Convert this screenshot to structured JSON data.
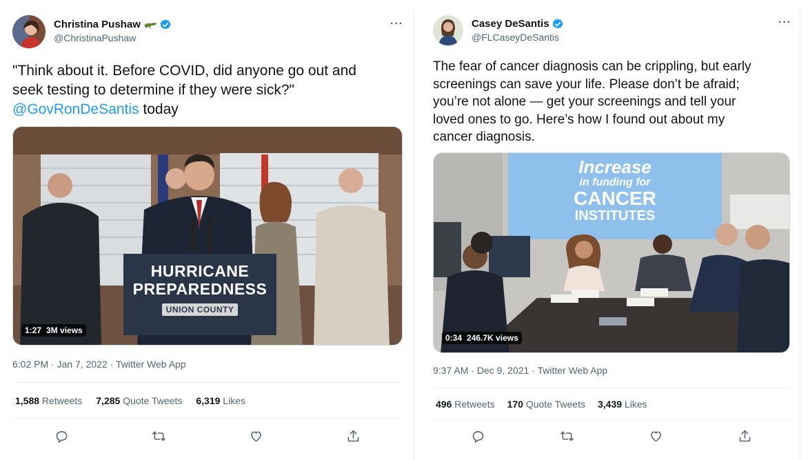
{
  "left": {
    "name": "Christina Pushaw",
    "name_emoji": "alligator-emoji",
    "handle": "@ChristinaPushaw",
    "text_line1": "\"Think about it. Before COVID, did anyone go out and",
    "text_line2": "seek testing to determine if they were sick?\"",
    "mention": "@GovRonDeSantis",
    "text_after_mention": " today",
    "video_duration": "1:27",
    "video_views": "3M views",
    "podium_line1": "HURRICANE",
    "podium_line2": "PREPAREDNESS",
    "podium_line3": "UNION COUNTY",
    "timestamp": "6:02 PM · Jan 7, 2022 · Twitter Web App",
    "retweets": "1,588",
    "retweets_label": " Retweets",
    "quotes": "7,285",
    "quotes_label": " Quote Tweets",
    "likes": "6,319",
    "likes_label": " Likes"
  },
  "right": {
    "name": "Casey DeSantis",
    "handle": "@FLCaseyDeSantis",
    "text_lines": [
      "The fear of cancer diagnosis can be crippling, but early",
      "screenings can save your life. Please don’t be afraid;",
      "you’re not alone — get your screenings and tell your",
      "loved ones to go. Here’s how I found out about my",
      "cancer diagnosis."
    ],
    "screen_line1": "Increase",
    "screen_line2": "in funding for",
    "screen_line3": "CANCER",
    "screen_line4": "INSTITUTES",
    "video_duration": "0:34",
    "video_views": "246.7K views",
    "timestamp": "9:37 AM · Dec 9, 2021 · Twitter Web App",
    "retweets": "496",
    "retweets_label": " Retweets",
    "quotes": "170",
    "quotes_label": " Quote Tweets",
    "likes": "3,439",
    "likes_label": " Likes"
  },
  "more_label": "···",
  "colors": {
    "verified": "#1d9bf0",
    "link": "#1d9bf0",
    "muted": "#536471"
  }
}
